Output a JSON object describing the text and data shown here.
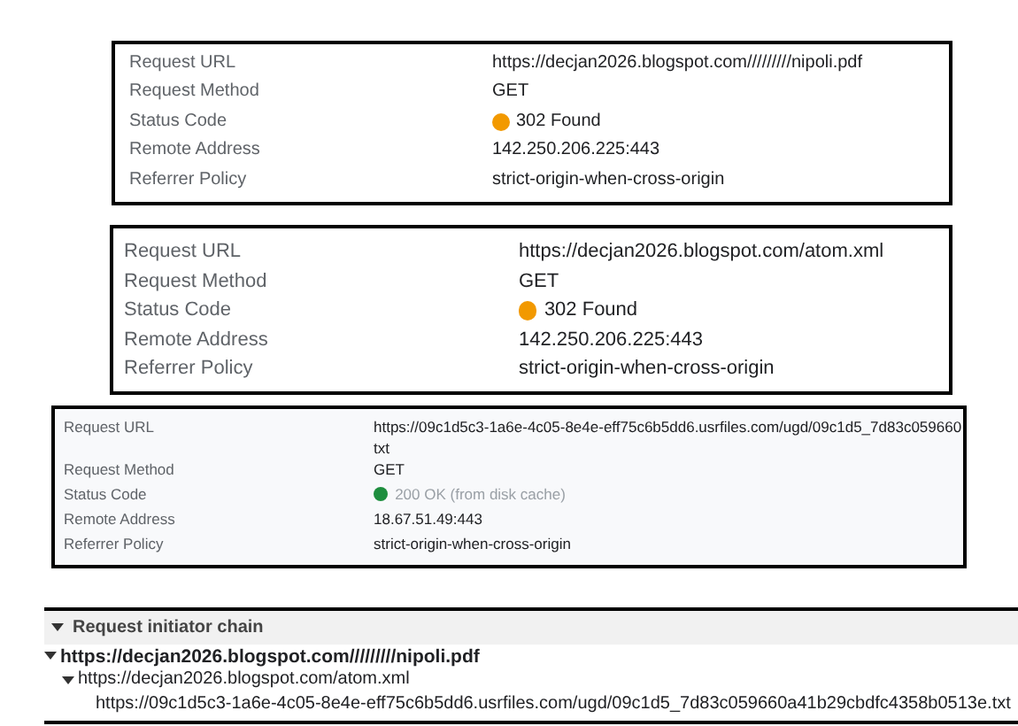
{
  "panels": [
    {
      "rows": [
        {
          "label": "Request URL",
          "value": [
            "https://decjan2026.blogspot.com/////////nipoli.pdf"
          ]
        },
        {
          "label": "Request Method",
          "value": [
            "GET"
          ]
        },
        {
          "label": "Status Code",
          "value": [
            "302 Found"
          ],
          "color": "#f29900",
          "greyed": false
        },
        {
          "label": "Remote Address",
          "value": [
            "142.250.206.225:443"
          ]
        },
        {
          "label": "Referrer Policy",
          "value": [
            "strict-origin-when-cross-origin"
          ]
        }
      ]
    },
    {
      "rows": [
        {
          "label": "Request URL",
          "value": [
            "https://decjan2026.blogspot.com/atom.xml"
          ]
        },
        {
          "label": "Request Method",
          "value": [
            "GET"
          ]
        },
        {
          "label": "Status Code",
          "value": [
            "302 Found"
          ],
          "color": "#f29900",
          "greyed": false
        },
        {
          "label": "Remote Address",
          "value": [
            "142.250.206.225:443"
          ]
        },
        {
          "label": "Referrer Policy",
          "value": [
            "strict-origin-when-cross-origin"
          ]
        }
      ]
    },
    {
      "rows": [
        {
          "label": "Request URL",
          "value": [
            "https://09c1d5c3-1a6e-4c05-8e4e-eff75c6b5dd6.usrfiles.com/ugd/09c1d5_7d83c059660",
            "txt"
          ]
        },
        {
          "label": "Request Method",
          "value": [
            "GET"
          ]
        },
        {
          "label": "Status Code",
          "value": [
            "200 OK (from disk cache)"
          ],
          "color": "#1e8e3e",
          "greyed": true
        },
        {
          "label": "Remote Address",
          "value": [
            "18.67.51.49:443"
          ]
        },
        {
          "label": "Referrer Policy",
          "value": [
            "strict-origin-when-cross-origin"
          ]
        }
      ]
    }
  ],
  "initiator_chain": {
    "title": "Request initiator chain",
    "expanded": true,
    "items": [
      {
        "url": "https://decjan2026.blogspot.com/////////nipoli.pdf",
        "current": true,
        "expanded": true,
        "children": [
          {
            "url": "https://decjan2026.blogspot.com/atom.xml",
            "current": false,
            "expanded": true,
            "children": [
              {
                "url": "https://09c1d5c3-1a6e-4c05-8e4e-eff75c6b5dd6.usrfiles.com/ugd/09c1d5_7d83c059660a41b29cbdfc4358b0513e.txt",
                "current": false
              }
            ]
          }
        ]
      }
    ]
  }
}
